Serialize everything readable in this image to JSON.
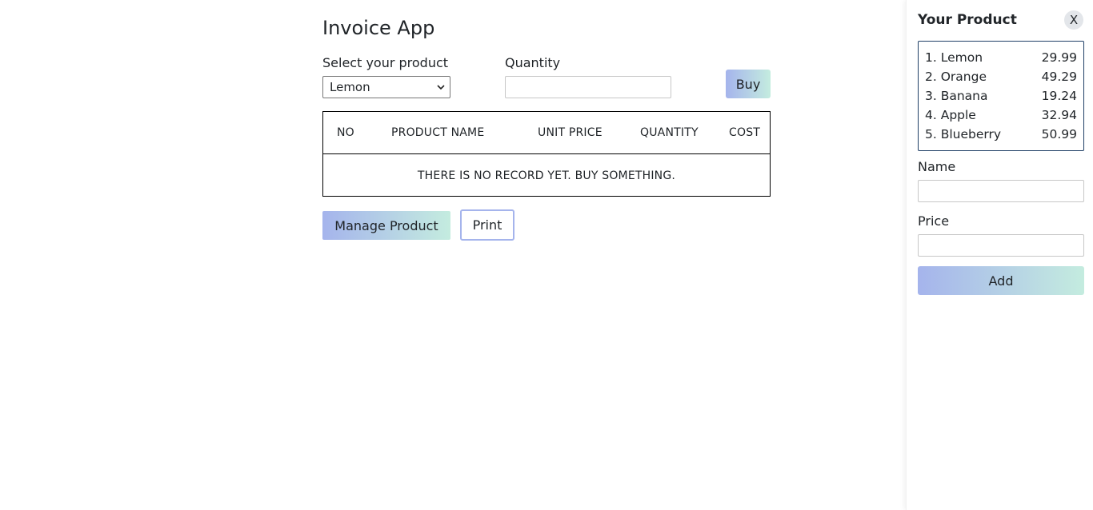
{
  "app": {
    "title": "Invoice App"
  },
  "form": {
    "product_label": "Select your product",
    "product_selected": "Lemon",
    "quantity_label": "Quantity",
    "quantity_value": "",
    "buy_label": "Buy"
  },
  "table": {
    "headers": [
      "NO",
      "PRODUCT NAME",
      "UNIT PRICE",
      "QUANTITY",
      "COST"
    ],
    "empty_message": "THERE IS NO RECORD YET. BUY SOMETHING."
  },
  "actions": {
    "manage_label": "Manage Product",
    "print_label": "Print"
  },
  "panel": {
    "title": "Your Product",
    "close_label": "X",
    "products": [
      {
        "label": "1. Lemon",
        "price": "29.99"
      },
      {
        "label": "2. Orange",
        "price": "49.29"
      },
      {
        "label": "3. Banana",
        "price": "19.24"
      },
      {
        "label": "4. Apple",
        "price": "32.94"
      },
      {
        "label": "5. Blueberry",
        "price": "50.99"
      }
    ],
    "name_label": "Name",
    "name_value": "",
    "price_label": "Price",
    "price_value": "",
    "add_label": "Add"
  },
  "colors": {
    "gradient_start": "#a5b4ec",
    "gradient_end": "#c4ecdf",
    "list_border": "#1f3f66"
  },
  "icons": {
    "select_arrow": "chevron-down-icon"
  }
}
